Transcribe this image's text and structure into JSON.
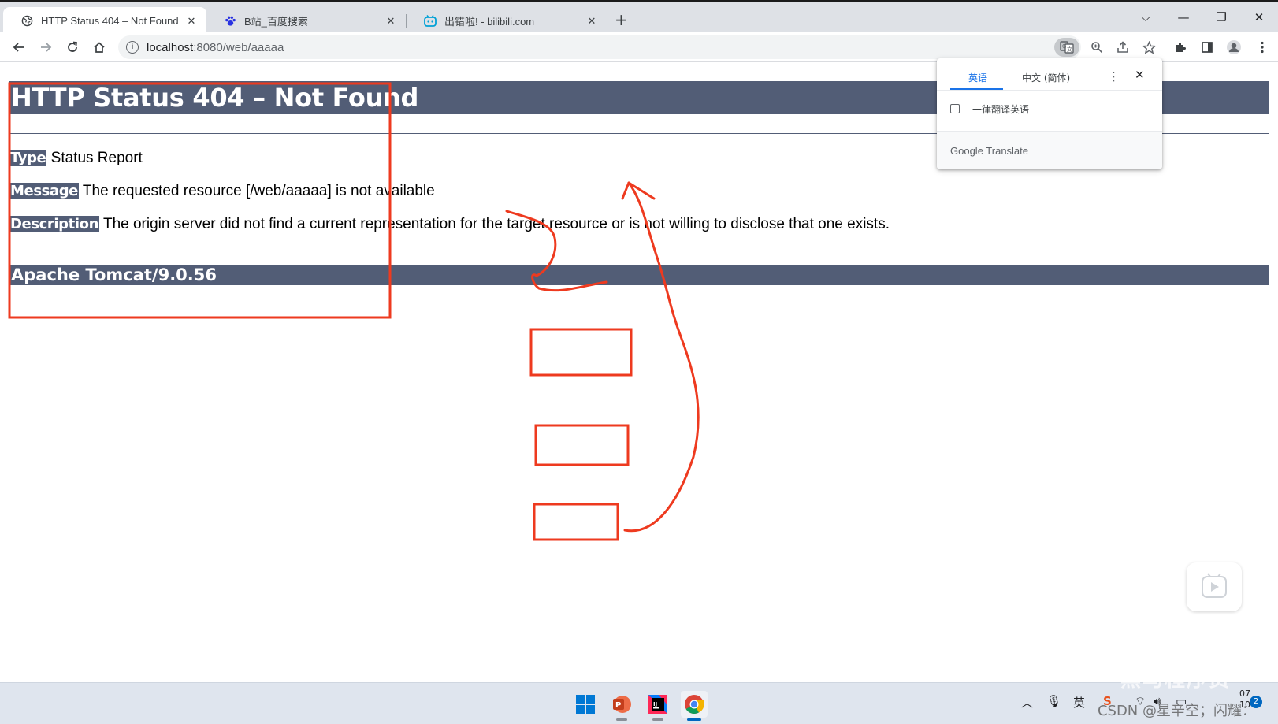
{
  "browser": {
    "tabs": [
      {
        "title": "HTTP Status 404 – Not Found",
        "icon": "globe-icon",
        "active": true
      },
      {
        "title": "B站_百度搜索",
        "icon": "baidu-paw-icon",
        "active": false
      },
      {
        "title": "出错啦! - bilibili.com",
        "icon": "bilibili-tv-icon",
        "active": false
      }
    ],
    "new_tab_label": "+",
    "window_controls": {
      "tab_search": "⌵",
      "minimize": "—",
      "restore": "❐",
      "close": "✕"
    },
    "address": {
      "host": "localhost",
      "rest": ":8080/web/aaaaa"
    }
  },
  "page": {
    "heading": "HTTP Status 404 – Not Found",
    "type_label": "Type",
    "type_value": " Status Report",
    "message_label": "Message",
    "message_value": " The requested resource [/web/aaaaa] is not available",
    "description_label": "Description",
    "description_value": " The origin server did not find a current representation for the target resource or is not willing to disclose that one exists.",
    "footer_heading": "Apache Tomcat/9.0.56",
    "header_color": "#525d76"
  },
  "translate_popup": {
    "source_lang": "英语",
    "target_lang": "中文 (简体)",
    "always_translate_label": "一律翻译英语",
    "brand": "Google Translate",
    "menu_glyph": "⋮",
    "close_glyph": "✕"
  },
  "annotation_color": "#ee3a1f",
  "taskbar": {
    "apps": [
      "windows-start-icon",
      "powerpoint-icon",
      "intellij-icon",
      "chrome-icon"
    ],
    "tray": {
      "ime": "英",
      "clock_line1": "07",
      "clock_line2": "10",
      "notification_count": "2"
    },
    "watermark": "CSDN @星辛空；闪耀：",
    "overlay_text": "黑马程序员"
  }
}
